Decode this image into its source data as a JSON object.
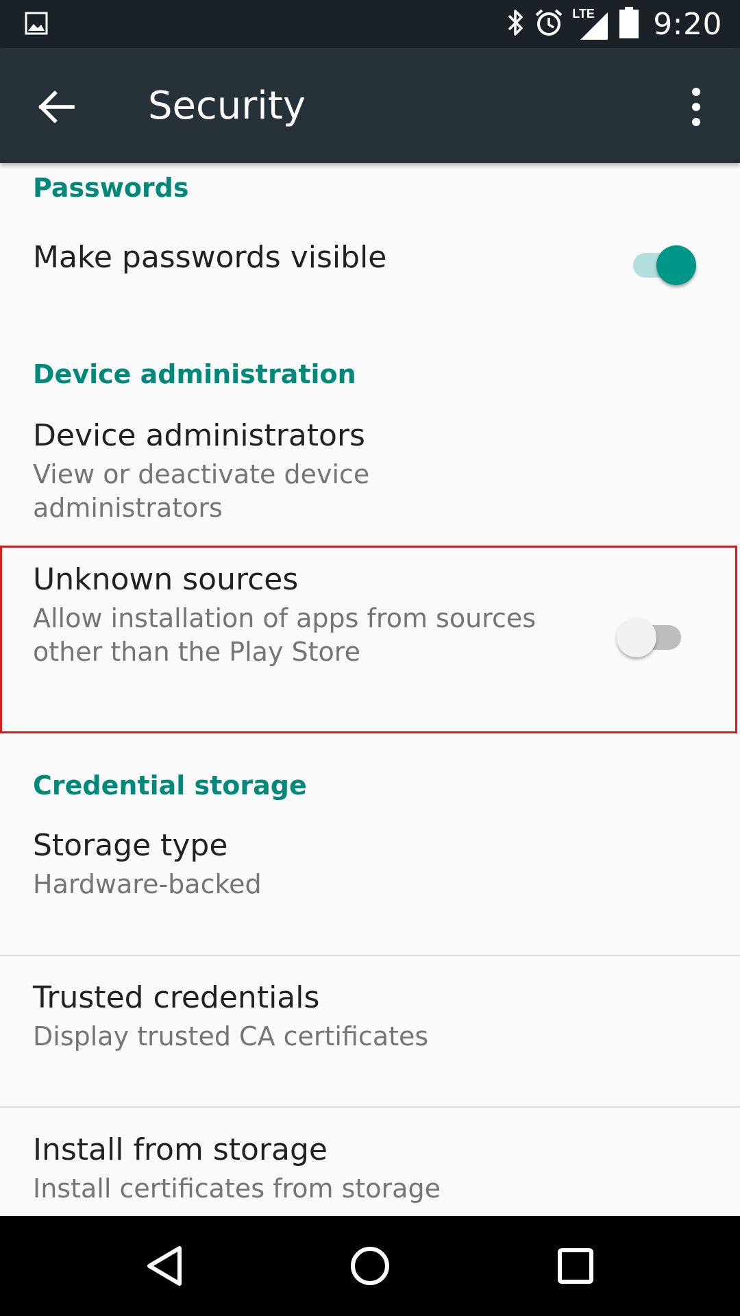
{
  "status_bar": {
    "time": "9:20",
    "network_label": "LTE",
    "icons": [
      "gallery-icon",
      "bluetooth-icon",
      "alarm-icon",
      "lte-signal-icon",
      "battery-icon"
    ]
  },
  "app_bar": {
    "title": "Security",
    "back_icon": "arrow-back-icon",
    "menu_icon": "more-vert-icon"
  },
  "sections": {
    "passwords": {
      "header": "Passwords",
      "make_visible": {
        "title": "Make passwords visible",
        "toggle_on": true
      }
    },
    "device_admin": {
      "header": "Device administration",
      "administrators": {
        "title": "Device administrators",
        "summary": "View or deactivate device administrators"
      },
      "unknown_sources": {
        "title": "Unknown sources",
        "summary": "Allow installation of apps from sources other than the Play Store",
        "toggle_on": false
      }
    },
    "credential_storage": {
      "header": "Credential storage",
      "storage_type": {
        "title": "Storage type",
        "summary": "Hardware-backed"
      },
      "trusted_credentials": {
        "title": "Trusted credentials",
        "summary": "Display trusted CA certificates"
      },
      "install_from_storage": {
        "title": "Install from storage",
        "summary": "Install certificates from storage"
      }
    }
  },
  "nav_bar": {
    "icons": [
      "back-triangle-icon",
      "home-circle-icon",
      "recents-square-icon"
    ]
  },
  "colors": {
    "accent": "#00897b",
    "app_bar": "#263238",
    "status_bar": "#1b2227",
    "highlight_border": "#d81b1b"
  }
}
